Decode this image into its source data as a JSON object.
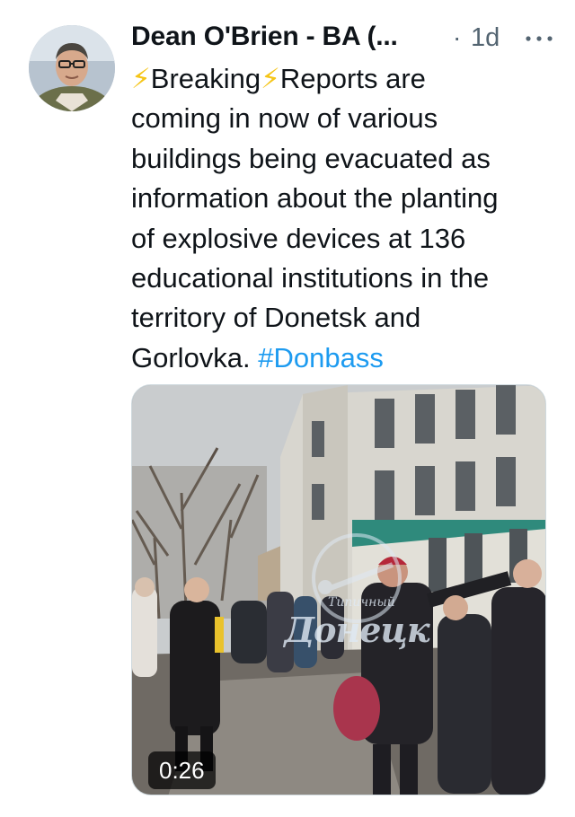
{
  "tweet": {
    "author": {
      "display_name": "Dean O'Brien - BA (...",
      "avatar_icon": "profile-photo-avatar"
    },
    "separator": "·",
    "timestamp": "1d",
    "more_icon": "more-options-icon",
    "text_lines": [
      {
        "bolt1": "⚡",
        "a": "Breaking",
        "bolt2": "⚡",
        "b": "Reports are"
      },
      "coming in now of various",
      "buildings being evacuated as",
      "information about the planting",
      "of explosive devices at 136",
      "educational institutions in the",
      "territory of Donetsk and",
      {
        "a": "Gorlovka. ",
        "hashtag": "#Donbass"
      }
    ],
    "media": {
      "type": "video",
      "duration": "0:26",
      "watermark_main": "Донецк",
      "watermark_small": "Типичный"
    },
    "colors": {
      "hashtag": "#1d9bf0",
      "secondary_text": "#536471",
      "primary_text": "#0f1419",
      "bolt": "#f5c518"
    }
  }
}
